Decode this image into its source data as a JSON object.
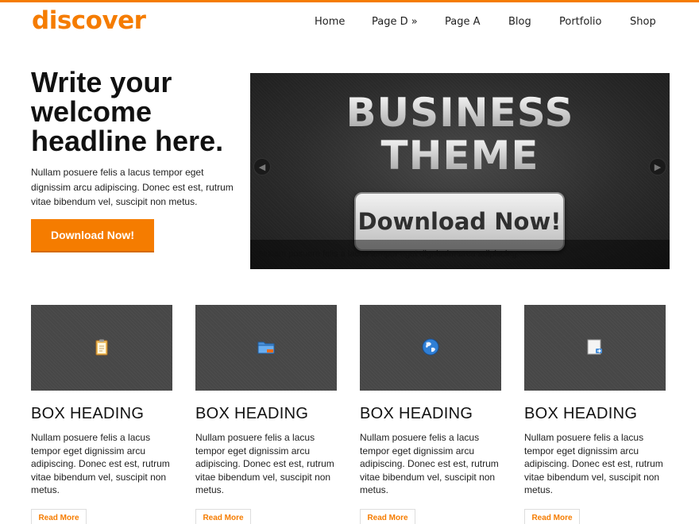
{
  "header": {
    "logo": "discover",
    "nav": [
      {
        "label": "Home"
      },
      {
        "label": "Page D »"
      },
      {
        "label": "Page A"
      },
      {
        "label": "Blog"
      },
      {
        "label": "Portfolio"
      },
      {
        "label": "Shop"
      }
    ]
  },
  "hero": {
    "title_line1": "Write your",
    "title_line2": "welcome",
    "title_line3": "headline here.",
    "text": "Nullam posuere felis a lacus tempor eget dignissim arcu adipiscing. Donec est est, rutrum vitae bibendum vel, suscipit non metus.",
    "button": "Download Now!"
  },
  "slider": {
    "line1": "BUSINESS",
    "line2": "THEME",
    "cta": "Download Now!",
    "caption": "Nullam posuere felis a lacus tempor eget dignissim arcu adipiscing.",
    "prev_icon": "chevron-left-icon",
    "next_icon": "chevron-right-icon"
  },
  "boxes": [
    {
      "icon": "clipboard-icon",
      "heading": "BOX HEADING",
      "text": "Nullam posuere felis a lacus tempor eget dignissim arcu adipiscing. Donec est est, rutrum vitae bibendum vel, suscipit non metus.",
      "link": "Read More"
    },
    {
      "icon": "folder-icon",
      "heading": "BOX HEADING",
      "text": "Nullam posuere felis a lacus tempor eget dignissim arcu adipiscing. Donec est est, rutrum vitae bibendum vel, suscipit non metus.",
      "link": "Read More"
    },
    {
      "icon": "globe-icon",
      "heading": "BOX HEADING",
      "text": "Nullam posuere felis a lacus tempor eget dignissim arcu adipiscing. Donec est est, rutrum vitae bibendum vel, suscipit non metus.",
      "link": "Read More"
    },
    {
      "icon": "document-arrow-icon",
      "heading": "BOX HEADING",
      "text": "Nullam posuere felis a lacus tempor eget dignissim arcu adipiscing. Donec est est, rutrum vitae bibendum vel, suscipit non metus.",
      "link": "Read More"
    }
  ],
  "colors": {
    "accent": "#f57c00",
    "text": "#222222",
    "box_image": "#474747"
  }
}
